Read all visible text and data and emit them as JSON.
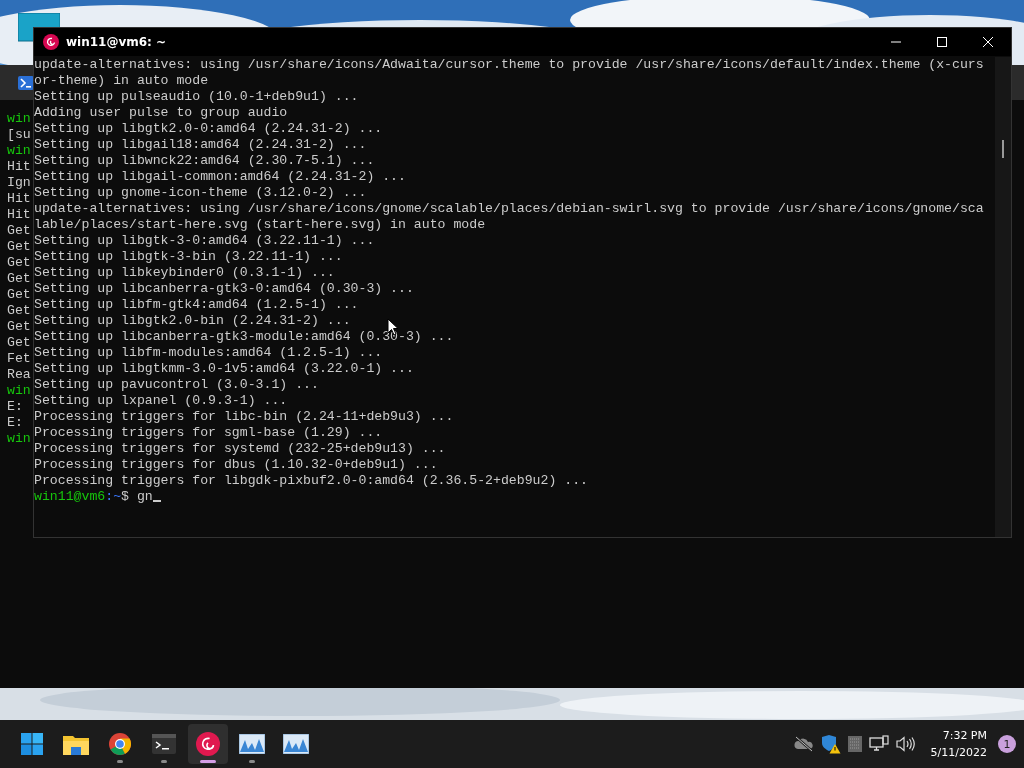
{
  "background_terminal": {
    "lines": [
      {
        "kind": "prompt",
        "text": "win"
      },
      {
        "kind": "output",
        "text": "[su"
      },
      {
        "kind": "prompt",
        "text": "win"
      },
      {
        "kind": "output",
        "text": "Hit"
      },
      {
        "kind": "output",
        "text": "Ign"
      },
      {
        "kind": "output",
        "text": "Hit"
      },
      {
        "kind": "output",
        "text": "Hit"
      },
      {
        "kind": "output",
        "text": "Get"
      },
      {
        "kind": "output",
        "text": "Get"
      },
      {
        "kind": "output",
        "text": "Get"
      },
      {
        "kind": "output",
        "text": "Get"
      },
      {
        "kind": "output",
        "text": "Get"
      },
      {
        "kind": "output",
        "text": "Get"
      },
      {
        "kind": "output",
        "text": "Get"
      },
      {
        "kind": "output",
        "text": "Get"
      },
      {
        "kind": "output",
        "text": "Fet"
      },
      {
        "kind": "output",
        "text": "Rea"
      },
      {
        "kind": "prompt",
        "text": "win"
      },
      {
        "kind": "output",
        "text": "E:"
      },
      {
        "kind": "output",
        "text": "E:"
      },
      {
        "kind": "prompt",
        "text": "win"
      }
    ]
  },
  "window": {
    "title": "win11@vm6: ~"
  },
  "terminal": {
    "lines": [
      "update-alternatives: using /usr/share/icons/Adwaita/cursor.theme to provide /usr/share/icons/default/index.theme (x-curs",
      "or-theme) in auto mode",
      "Setting up pulseaudio (10.0-1+deb9u1) ...",
      "Adding user pulse to group audio",
      "Setting up libgtk2.0-0:amd64 (2.24.31-2) ...",
      "Setting up libgail18:amd64 (2.24.31-2) ...",
      "Setting up libwnck22:amd64 (2.30.7-5.1) ...",
      "Setting up libgail-common:amd64 (2.24.31-2) ...",
      "Setting up gnome-icon-theme (3.12.0-2) ...",
      "update-alternatives: using /usr/share/icons/gnome/scalable/places/debian-swirl.svg to provide /usr/share/icons/gnome/sca",
      "lable/places/start-here.svg (start-here.svg) in auto mode",
      "Setting up libgtk-3-0:amd64 (3.22.11-1) ...",
      "Setting up libgtk-3-bin (3.22.11-1) ...",
      "Setting up libkeybinder0 (0.3.1-1) ...",
      "Setting up libcanberra-gtk3-0:amd64 (0.30-3) ...",
      "Setting up libfm-gtk4:amd64 (1.2.5-1) ...",
      "Setting up libgtk2.0-bin (2.24.31-2) ...",
      "Setting up libcanberra-gtk3-module:amd64 (0.30-3) ...",
      "Setting up libfm-modules:amd64 (1.2.5-1) ...",
      "Setting up libgtkmm-3.0-1v5:amd64 (3.22.0-1) ...",
      "Setting up pavucontrol (3.0-3.1) ...",
      "Setting up lxpanel (0.9.3-1) ...",
      "Processing triggers for libc-bin (2.24-11+deb9u3) ...",
      "Processing triggers for sgml-base (1.29) ...",
      "Processing triggers for systemd (232-25+deb9u13) ...",
      "Processing triggers for dbus (1.10.32-0+deb9u1) ...",
      "Processing triggers for libgdk-pixbuf2.0-0:amd64 (2.36.5-2+deb9u2) ..."
    ],
    "prompt": {
      "user": "win11@vm6",
      "path": ":~",
      "command": "$ gn"
    }
  },
  "taskbar": {
    "apps": [
      {
        "kind": "start",
        "running": false,
        "selected": false
      },
      {
        "kind": "folder",
        "running": false,
        "selected": false
      },
      {
        "kind": "browser",
        "running": true,
        "selected": false
      },
      {
        "kind": "terminal",
        "running": true,
        "selected": false
      },
      {
        "kind": "debian",
        "running": true,
        "selected": true
      },
      {
        "kind": "monitor",
        "running": true,
        "selected": false
      },
      {
        "kind": "monitor",
        "running": false,
        "selected": false
      }
    ],
    "time": "7:32 PM",
    "date": "5/11/2022",
    "notifications": "1"
  }
}
